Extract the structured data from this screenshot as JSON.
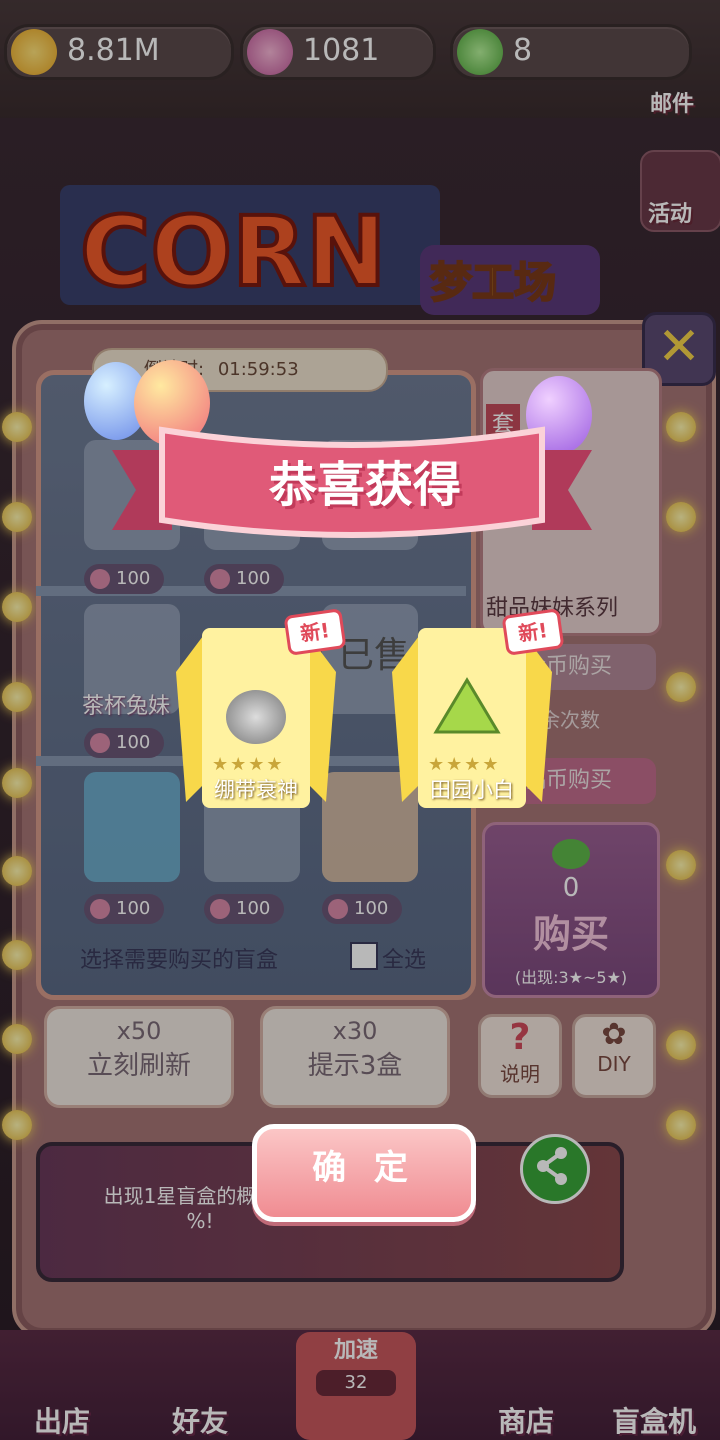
{
  "currency": {
    "gold": "8.81M",
    "crown": "1081",
    "frog": "8"
  },
  "mail_label": "邮件",
  "activity_label": "活动",
  "logo_text": "CORN",
  "logo_sub": "梦工场",
  "timer": {
    "label": "倒计时:",
    "value": "01:59:53"
  },
  "shelf": {
    "prices": [
      "100",
      "100",
      "100",
      "100",
      "100",
      "100"
    ],
    "item_labels": [
      "茶杯兔妹",
      "已售"
    ],
    "select_label": "选择需要购买的盲盒",
    "select_all": "全选"
  },
  "actions": [
    {
      "cost": "x50",
      "label": "立刻刷新"
    },
    {
      "cost": "x30",
      "label": "提示3盒"
    }
  ],
  "right": {
    "series": "甜品妹妹系列",
    "tag": "套",
    "coin_buy": "金币购买",
    "remaining": "剩余次数",
    "doll_buy": "偶币购买",
    "buy_count": "0",
    "buy_label": "购买",
    "buy_note": "(出现:3★~5★)",
    "help": "说明",
    "diy": "DIY"
  },
  "banner": {
    "text": "出现1星盲盒的概率… %!"
  },
  "bottom_nav": [
    "出店",
    "好友",
    "加速",
    "商店",
    "盲盒机"
  ],
  "speed_value": "32",
  "overlay": {
    "title": "恭喜获得",
    "rewards": [
      {
        "name": "绷带衰神",
        "stars": 4,
        "tag": "新!"
      },
      {
        "name": "田园小白",
        "stars": 4,
        "tag": "新!"
      }
    ],
    "confirm": "确 定"
  },
  "colors": {
    "accent": "#f08c92",
    "gold": "#f6d34a",
    "ribbon": "#e05a78"
  }
}
